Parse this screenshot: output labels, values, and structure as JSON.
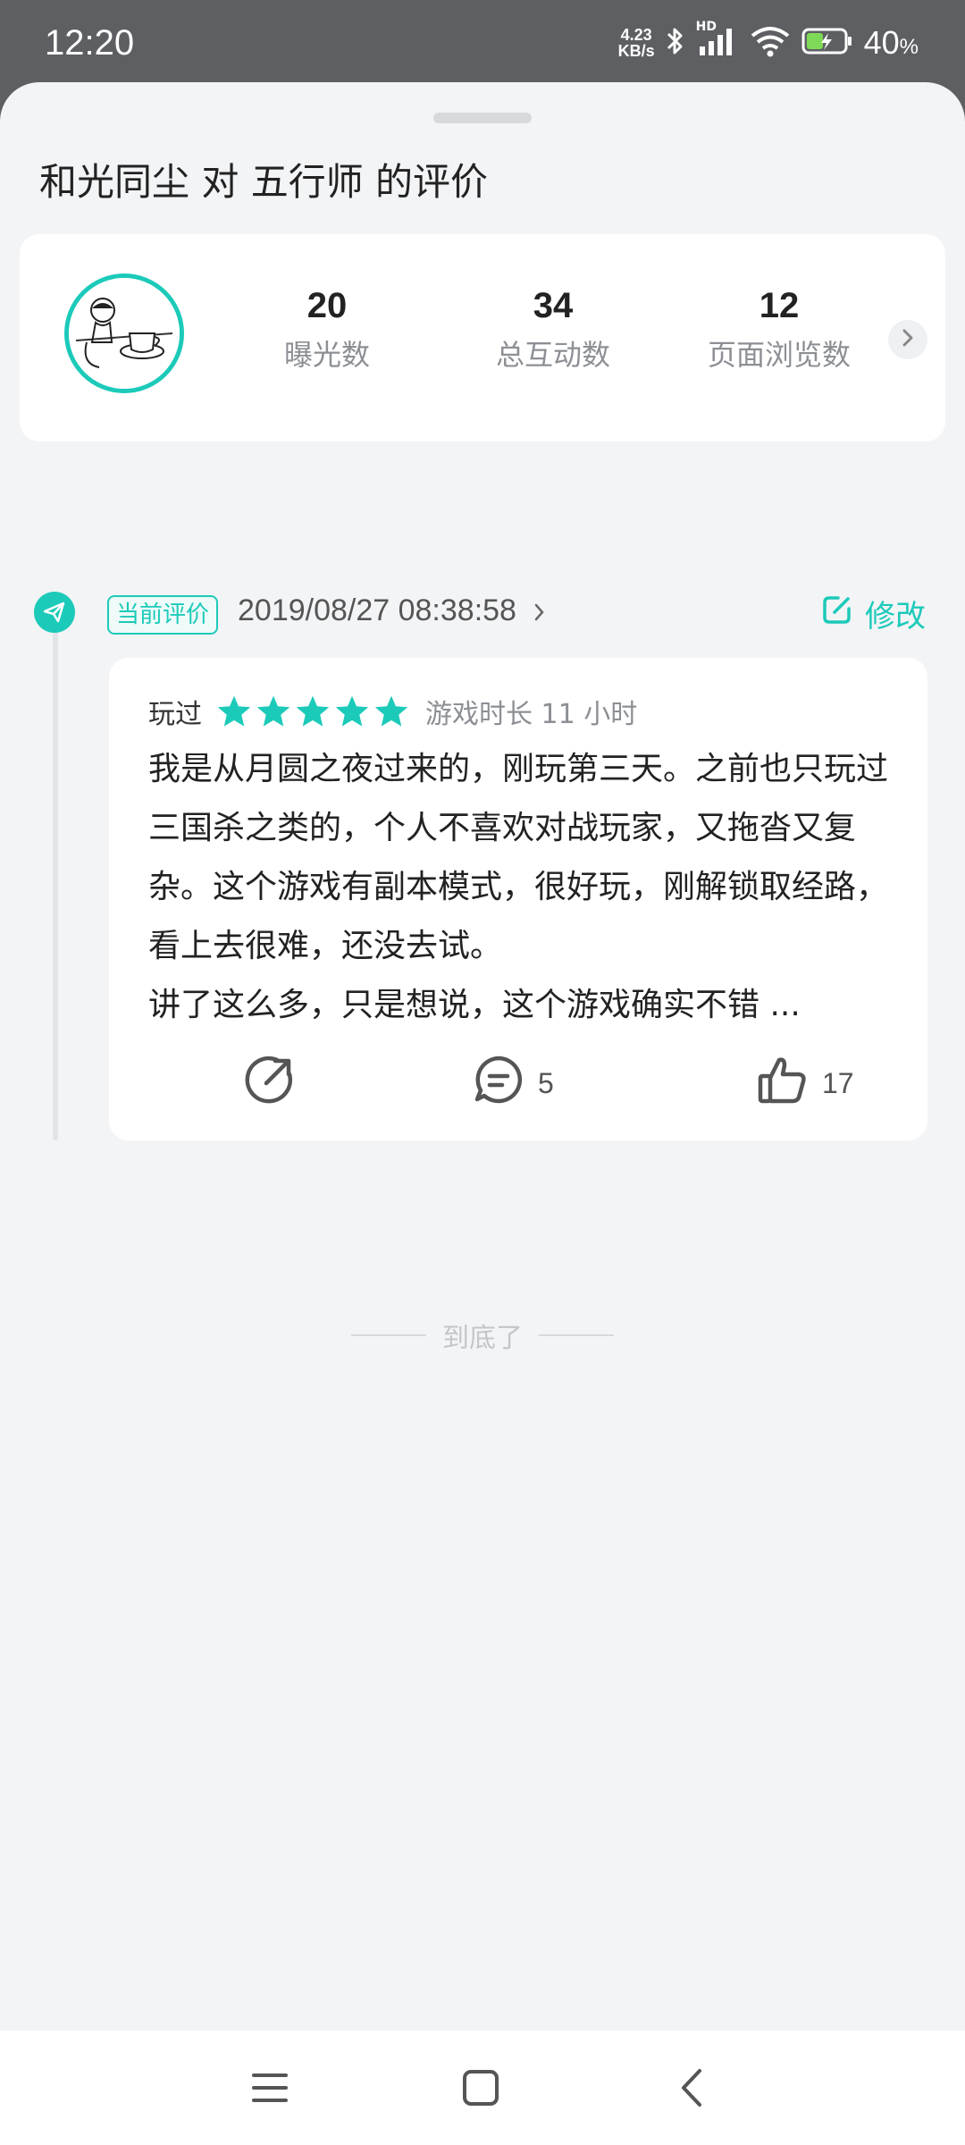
{
  "status_bar": {
    "time": "12:20",
    "net_speed_value": "4.23",
    "net_speed_unit": "KB/s",
    "network_badge": "HD",
    "battery_percent": "40",
    "battery_unit": "%"
  },
  "header": {
    "title": "和光同尘 对 五行师 的评价"
  },
  "stats": {
    "items": [
      {
        "value": "20",
        "label": "曝光数"
      },
      {
        "value": "34",
        "label": "总互动数"
      },
      {
        "value": "12",
        "label": "页面浏览数"
      }
    ]
  },
  "review": {
    "tag": "当前评价",
    "datetime": "2019/08/27 08:38:58",
    "edit_label": "修改",
    "played_label": "玩过",
    "stars": 5,
    "play_time": "游戏时长 11 小时",
    "text_lines": [
      "我是从月圆之夜过来的，刚玩第三天。之前也只玩过三国杀之类的，个人不喜欢对战玩家，又拖沓又复杂。这个游戏有副本模式，很好玩，刚解锁取经路，看上去很难，还没去试。",
      "讲了这么多，只是想说，这个游戏确实不错 ..."
    ],
    "comment_count": "5",
    "like_count": "17"
  },
  "footer": {
    "end_text": "到底了"
  },
  "colors": {
    "accent": "#1ccab9",
    "sheet_bg": "#f3f4f6",
    "card_bg": "#ffffff",
    "muted_text": "#8c8f94"
  },
  "icons": [
    "bluetooth-icon",
    "signal-icon",
    "wifi-icon",
    "battery-icon",
    "chevron-right-icon",
    "paper-plane-icon",
    "edit-icon",
    "star-icon",
    "share-icon",
    "comment-icon",
    "thumbs-up-icon",
    "menu-icon",
    "home-icon",
    "back-icon"
  ]
}
